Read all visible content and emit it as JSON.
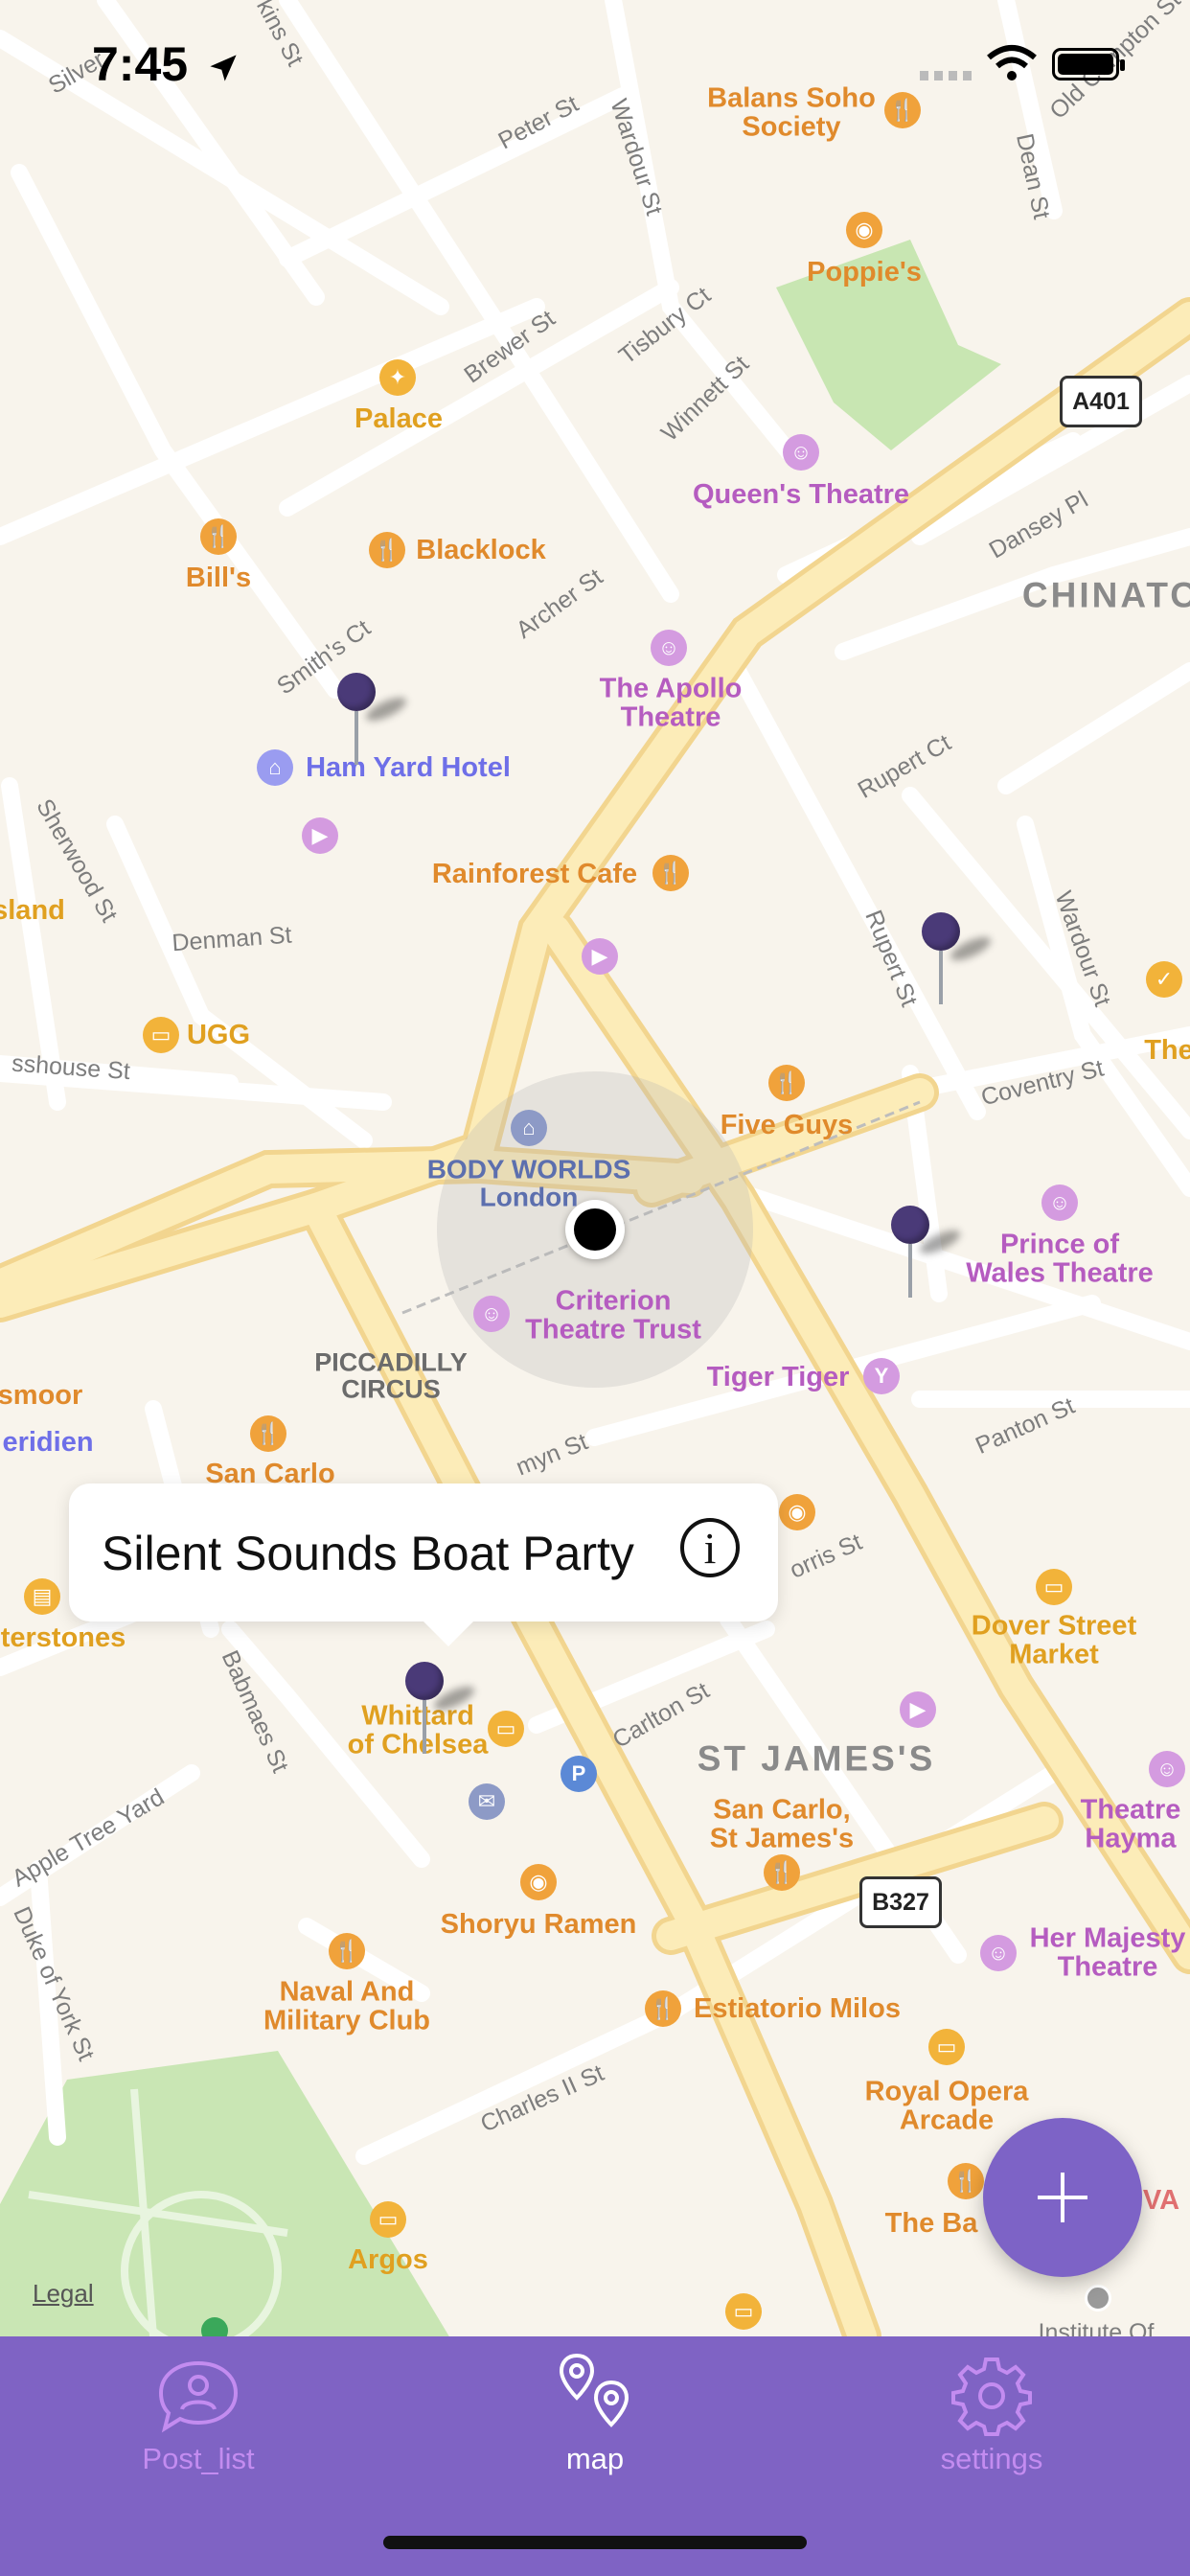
{
  "status_bar": {
    "time": "7:45"
  },
  "map": {
    "poi": {
      "balans": "Balans Soho\nSociety",
      "poppies": "Poppie's",
      "palace": "Palace",
      "queens": "Queen's Theatre",
      "bills": "Bill's",
      "blacklock": "Blacklock",
      "apollo": "The Apollo\nTheatre",
      "hamyard": "Ham Yard Hotel",
      "rainforest": "Rainforest Cafe",
      "ugg": "UGG",
      "island": "sland",
      "fiveguys": "Five Guys",
      "bodyworlds": "BODY WORLDS\nLondon",
      "criterion": "Criterion\nTheatre Trust",
      "piccadilly": "PICCADILLY\nCIRCUS",
      "prince": "Prince of\nWales Theatre",
      "tiger": "Tiger Tiger",
      "smoor": "smoor",
      "eridien": "eridien",
      "sancarlo": "San Carlo",
      "terstones": "terstones",
      "whittard": "Whittard\nof Chelsea",
      "dover": "Dover Street\nMarket",
      "sancarlo2": "San Carlo,\nSt James's",
      "theatre_hay": "Theatre\nHayma",
      "shoryu": "Shoryu Ramen",
      "hermaj": "Her Majesty\nTheatre",
      "naval": "Naval And\nMilitary Club",
      "estiatorio": "Estiatorio Milos",
      "royalopera": "Royal Opera\nArcade",
      "theba": "The Ba",
      "argos": "Argos",
      "the_right": "The",
      "institute": "Institute Of",
      "va": "VA"
    },
    "streets": {
      "silver": "Silver",
      "kins": "kins St",
      "peter": "Peter St",
      "wardour1": "Wardour St",
      "dean": "Dean St",
      "oldcompton": "Old Compton St",
      "brewer": "Brewer St",
      "tisbury": "Tisbury Ct",
      "winnett": "Winnett St",
      "dansey": "Dansey Pl",
      "smiths": "Smith's Ct",
      "archer": "Archer St",
      "sherwood": "Sherwood St",
      "denman": "Denman St",
      "rupertct": "Rupert Ct",
      "rupertst": "Rupert St",
      "wardour2": "Wardour St",
      "glasshouse": "sshouse St",
      "coventry": "Coventry St",
      "jermyn": "myn St",
      "panton": "Panton St",
      "orris": "orris St",
      "babmaes": "Babmaes St",
      "carlton": "Carlton St",
      "appletree": "Apple Tree Yard",
      "dukeofyork": "Duke of York St",
      "charles": "Charles II St"
    },
    "districts": {
      "chinatown": "CHINATO",
      "stjames": "ST JAMES'S"
    },
    "road_badges": {
      "a401": "A401",
      "b327": "B327"
    },
    "legal": "Legal"
  },
  "callout": {
    "title": "Silent Sounds Boat Party"
  },
  "tabbar": {
    "tabs": [
      {
        "label": "Post_list",
        "icon": "person-bubble-icon",
        "active": false
      },
      {
        "label": "map",
        "icon": "map-pins-icon",
        "active": true
      },
      {
        "label": "settings",
        "icon": "gear-icon",
        "active": false
      }
    ]
  },
  "colors": {
    "accent": "#7f63c4",
    "inactive_tab": "#c38cf0",
    "pin": "#4a3a78",
    "major_road": "#fbe7a6",
    "park": "#c9e6b4"
  }
}
